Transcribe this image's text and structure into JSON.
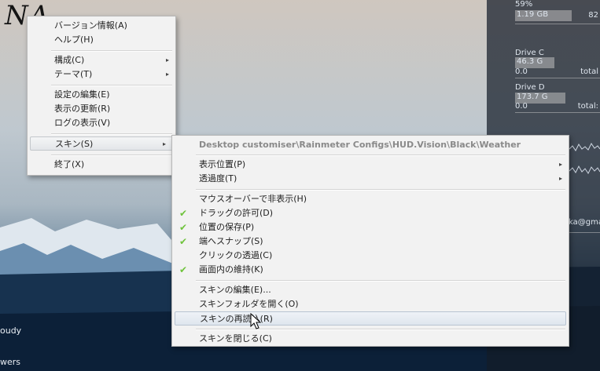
{
  "desktop": {
    "logo_text": "NA",
    "left_labels": [
      "oudy",
      "wers"
    ]
  },
  "hud": {
    "ram_percent": "59%",
    "ram_used": "1.19 GB",
    "ram_right": "82",
    "drive_c_label": "Drive C",
    "drive_c_value": "46.3 G",
    "drive_c_zero": "0.0",
    "drive_c_total": "total",
    "drive_d_label": "Drive D",
    "drive_d_value": "173.7 G",
    "drive_d_zero": "0.0",
    "drive_d_total": "total:",
    "email_fragment": "ka@gma"
  },
  "main_menu": {
    "items": [
      {
        "label": "バージョン情報(A)"
      },
      {
        "label": "ヘルプ(H)"
      },
      {
        "label": "構成(C)",
        "submenu": true
      },
      {
        "label": "テーマ(T)",
        "submenu": true
      },
      {
        "label": "設定の編集(E)"
      },
      {
        "label": "表示の更新(R)"
      },
      {
        "label": "ログの表示(V)"
      },
      {
        "label": "スキン(S)",
        "submenu": true
      },
      {
        "label": "終了(X)"
      }
    ]
  },
  "skin_menu": {
    "header": "Desktop customiser\\Rainmeter Configs\\HUD.Vision\\Black\\Weather",
    "items": [
      {
        "label": "表示位置(P)",
        "submenu": true
      },
      {
        "label": "透過度(T)",
        "submenu": true
      },
      {
        "label": "マウスオーバーで非表示(H)",
        "checked": false
      },
      {
        "label": "ドラッグの許可(D)",
        "checked": true
      },
      {
        "label": "位置の保存(P)",
        "checked": true
      },
      {
        "label": "端へスナップ(S)",
        "checked": true
      },
      {
        "label": "クリックの透過(C)",
        "checked": false
      },
      {
        "label": "画面内の維持(K)",
        "checked": true
      },
      {
        "label": "スキンの編集(E)..."
      },
      {
        "label": "スキンフォルダを開く(O)"
      },
      {
        "label": "スキンの再読込(R)"
      },
      {
        "label": "スキンを閉じる(C)"
      }
    ],
    "check_glyph": "✔",
    "arrow_glyph": "▸"
  }
}
